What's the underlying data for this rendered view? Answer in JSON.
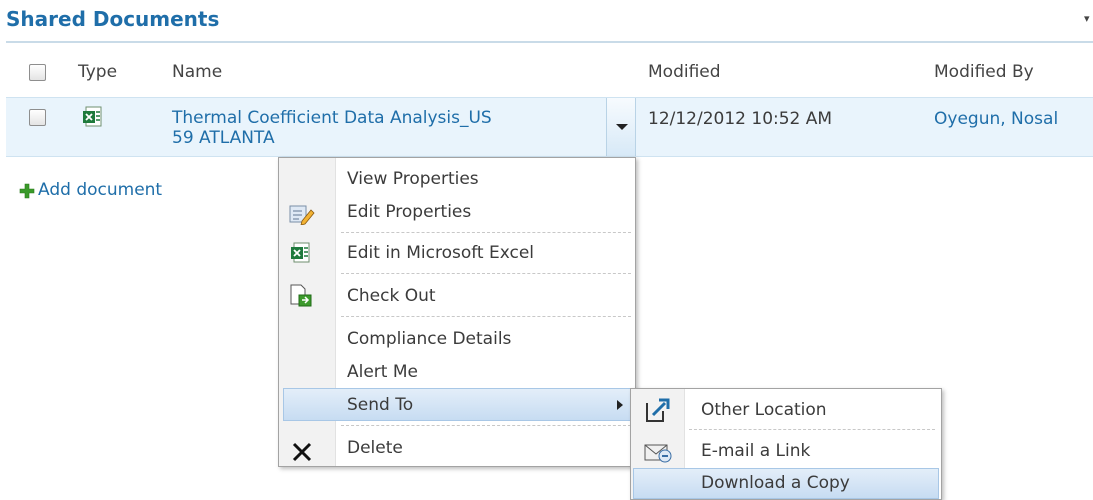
{
  "library": {
    "title": "Shared Documents"
  },
  "columns": {
    "type": "Type",
    "name": "Name",
    "modified": "Modified",
    "modified_by": "Modified By"
  },
  "row": {
    "name_line1": "Thermal Coefficient Data Analysis_US",
    "name_line2": "59 ATLANTA",
    "modified": "12/12/2012 10:52 AM",
    "modified_by": "Oyegun, Nosal",
    "type_icon": "excel-file-icon"
  },
  "add_document": "Add document",
  "menu": {
    "items": [
      {
        "label": "View Properties",
        "icon": ""
      },
      {
        "label": "Edit Properties",
        "icon": "edit-properties-icon"
      },
      {
        "label": "Edit in Microsoft Excel",
        "icon": "excel-icon"
      },
      {
        "label": "Check Out",
        "icon": "check-out-icon"
      },
      {
        "label": "Compliance Details",
        "icon": ""
      },
      {
        "label": "Alert Me",
        "icon": ""
      },
      {
        "label": "Send To",
        "icon": ""
      },
      {
        "label": "Delete",
        "icon": "delete-x-icon"
      }
    ]
  },
  "submenu": {
    "items": [
      {
        "label": "Other Location",
        "icon": "other-location-icon"
      },
      {
        "label": "E-mail a Link",
        "icon": "email-link-icon"
      },
      {
        "label": "Download a Copy",
        "icon": ""
      }
    ]
  },
  "colors": {
    "link": "#1f6ea9",
    "row_highlight": "#e9f4fc",
    "menu_hover": "#c7dcf2"
  }
}
